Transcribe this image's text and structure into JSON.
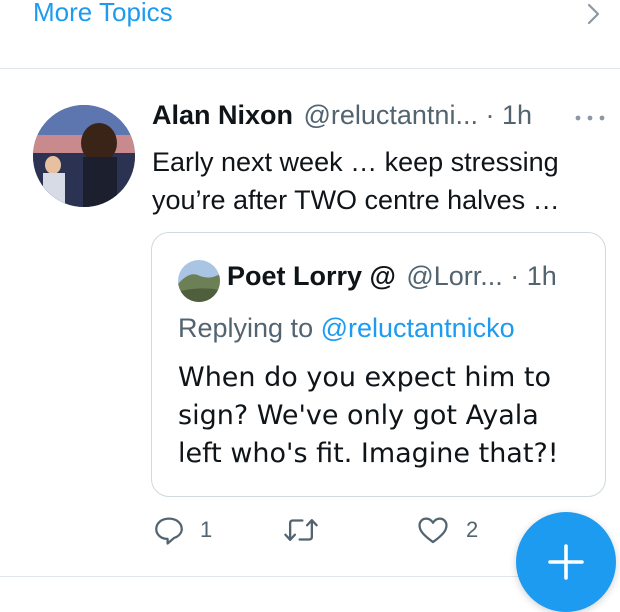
{
  "more_topics": {
    "label": "More Topics"
  },
  "tweet": {
    "name": "Alan Nixon",
    "handle_time": "@reluctantni... · 1h",
    "text": "Early next week … keep stressing you’re after TWO centre halves …"
  },
  "quote": {
    "name": "Poet Lorry @",
    "handle_time": "@Lorr... · 1h",
    "replying_prefix": "Replying to",
    "replying_mention": "@reluctantnicko",
    "text": "When do you expect him to sign? We've only got Ayala left who's fit. Imagine that?!"
  },
  "actions": {
    "reply_count": "1",
    "retweet_count": "",
    "like_count": "2"
  },
  "colors": {
    "accent": "#1d9bf0",
    "muted": "#536471",
    "text": "#0f1419"
  }
}
